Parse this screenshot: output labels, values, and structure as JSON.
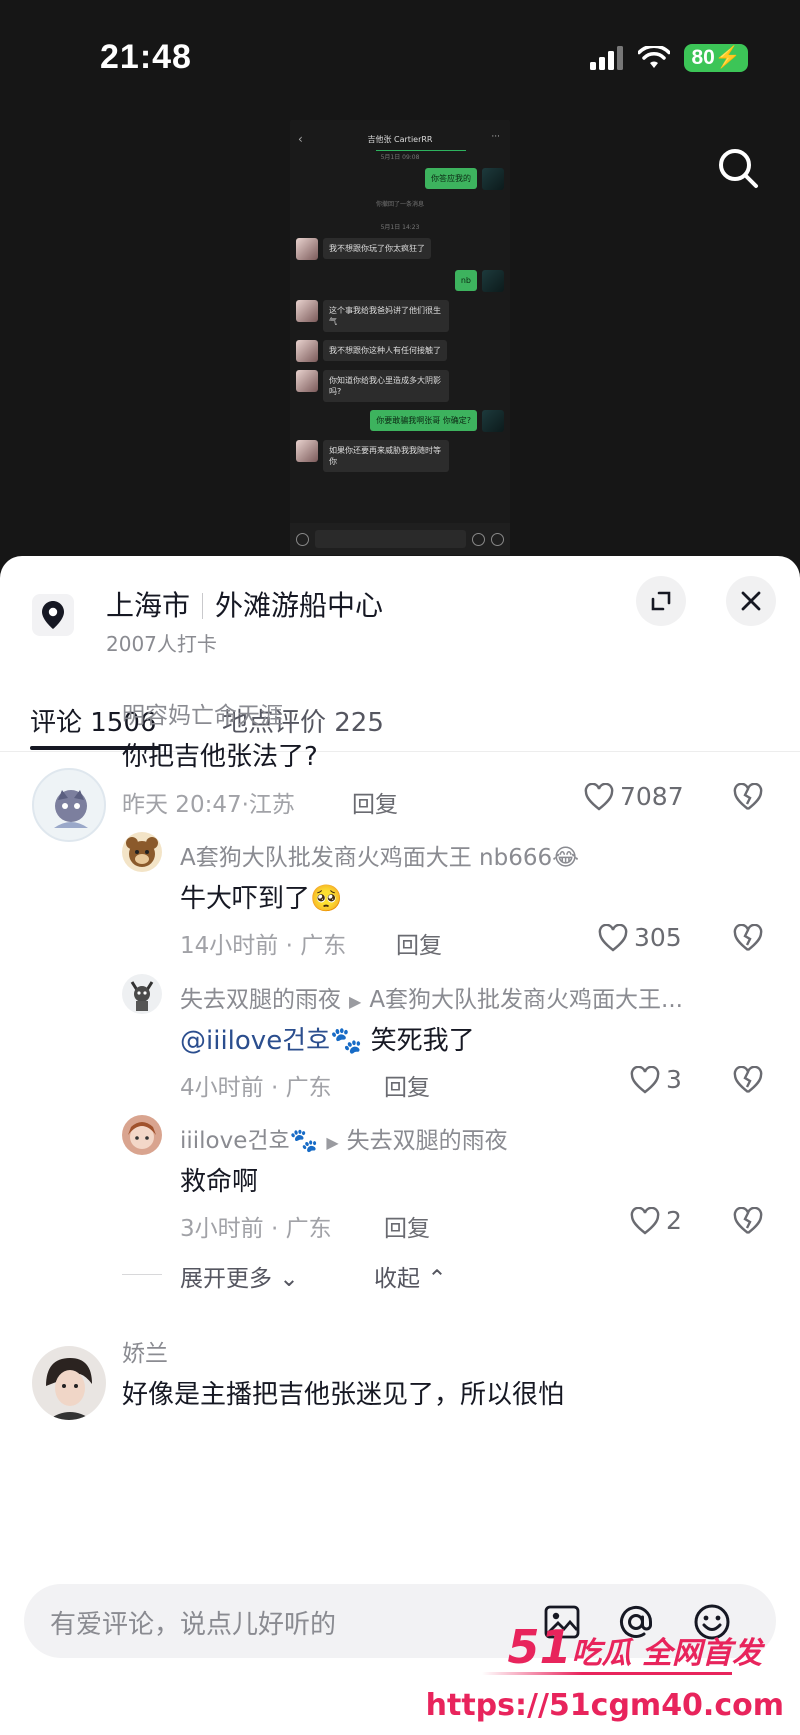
{
  "status": {
    "time": "21:48",
    "battery": "80"
  },
  "chat_preview": {
    "title": "吉他张 CartierRR",
    "messages": [
      {
        "side": "sys",
        "text": "5月1日 09:08"
      },
      {
        "side": "right",
        "text": "你答应我的"
      },
      {
        "side": "sys",
        "text": "你撤回了一条消息"
      },
      {
        "side": "sys",
        "text": "5月1日 14:23"
      },
      {
        "side": "left",
        "text": "我不想跟你玩了你太疯狂了"
      },
      {
        "side": "right",
        "text": "nb"
      },
      {
        "side": "left",
        "text": "这个事我给我爸妈讲了他们很生气"
      },
      {
        "side": "left",
        "text": "我不想跟你这种人有任何接触了"
      },
      {
        "side": "left",
        "text": "你知道你给我心里造成多大阴影吗?"
      },
      {
        "side": "right",
        "text": "你要敢骗我啊张哥 你确定?"
      },
      {
        "side": "left",
        "text": "如果你还要再来威胁我我随时等你"
      }
    ]
  },
  "location": {
    "city": "上海市",
    "place": "外滩游船中心",
    "checkins": "2007人打卡"
  },
  "tabs": [
    {
      "label": "评论 1506"
    },
    {
      "label": "地点评价 225"
    }
  ],
  "comments": [
    {
      "user": "明容妈亡命天涯",
      "text": "你把吉他张法了?",
      "meta": "昨天 20:47·江苏",
      "reply": "回复",
      "likes": "7087"
    },
    {
      "user": "A套狗大队批发商火鸡面大王 nb666😂",
      "text": "牛大吓到了🥺",
      "meta": "14小时前 · 广东",
      "reply": "回复",
      "likes": "305"
    },
    {
      "user": "失去双腿的雨夜",
      "reply_to": "A套狗大队批发商火鸡面大王...",
      "mention": "@iiilove건호🐾",
      "text": " 笑死我了",
      "meta": "4小时前 · 广东",
      "reply": "回复",
      "likes": "3"
    },
    {
      "user": "iiilove건호🐾",
      "reply_to": "失去双腿的雨夜",
      "text": "救命啊",
      "meta": "3小时前 · 广东",
      "reply": "回复",
      "likes": "2"
    },
    {
      "user": "娇兰",
      "text": "好像是主播把吉他张迷见了，所以很怕"
    }
  ],
  "thread_controls": {
    "expand": "展开更多",
    "collapse": "收起"
  },
  "input": {
    "placeholder": "有爱评论，说点儿好听的"
  },
  "watermark": {
    "logo_num": "51",
    "logo_text": "吃瓜 全网首发",
    "url": "https://51cgm40.com"
  },
  "colors": {
    "accent_pink": "#e8245c",
    "battery_green": "#3cc557",
    "mention_blue": "#2b4e8e"
  }
}
